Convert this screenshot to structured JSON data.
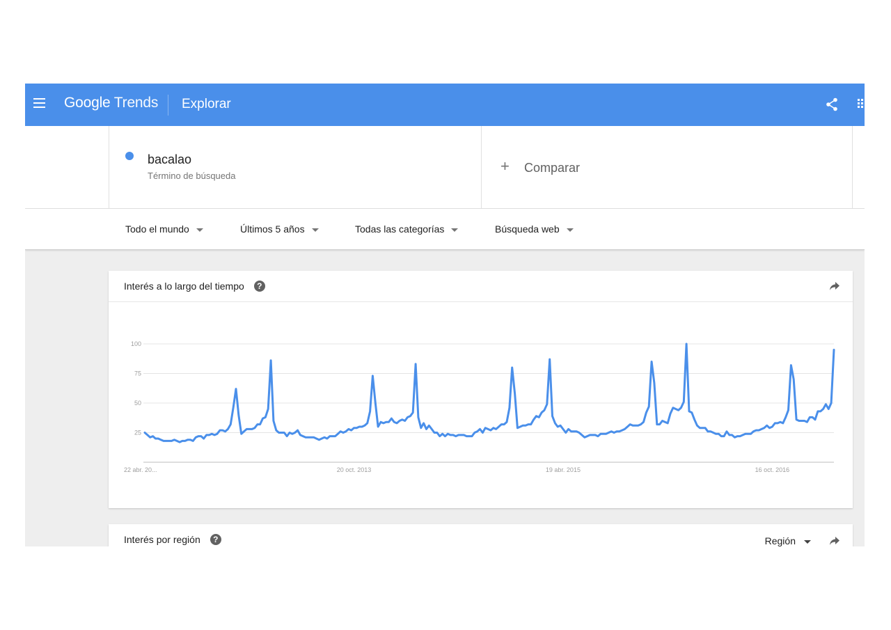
{
  "topbar": {
    "brand_google": "Google",
    "brand_trends": "Trends",
    "section": "Explorar",
    "menu_icon": "hamburger-menu-icon",
    "share_icon": "share-icon",
    "apps_icon": "apps-grid-icon"
  },
  "terms": {
    "term": "bacalao",
    "term_type": "Término de búsqueda",
    "term_color": "#4a8fea",
    "compare_label": "Comparar"
  },
  "filters": {
    "region": "Todo el mundo",
    "period": "Últimos 5 años",
    "category": "Todas las categorías",
    "search_type": "Búsqueda web"
  },
  "interest_over_time": {
    "title": "Interés a lo largo del tiempo",
    "help_icon": "help-icon",
    "share_icon": "share-arrow-icon"
  },
  "interest_by_region": {
    "title": "Interés por región",
    "resolution": "Región",
    "help_icon": "help-icon",
    "share_icon": "share-arrow-icon"
  },
  "colors": {
    "accent": "#4a8fea",
    "line": "#4a8fea",
    "background": "#eeeeee"
  },
  "chart_data": {
    "type": "line",
    "title": "",
    "xlabel": "",
    "ylabel": "",
    "ylim": [
      0,
      100
    ],
    "yticks": [
      25,
      50,
      75,
      100
    ],
    "x_tick_labels": [
      "22 abr. 20...",
      "20 oct. 2013",
      "19 abr. 2015",
      "16 oct. 2016"
    ],
    "x_tick_index": [
      0,
      78,
      156,
      234
    ],
    "grid": true,
    "series": [
      {
        "values": [
          25,
          23,
          21,
          22,
          20,
          20,
          19,
          18,
          18,
          18,
          18,
          19,
          18,
          17,
          18,
          18,
          19,
          19,
          18,
          21,
          22,
          22,
          20,
          23,
          23,
          24,
          23,
          24,
          27,
          27,
          26,
          28,
          32,
          46,
          62,
          40,
          24,
          26,
          28,
          28,
          28,
          29,
          32,
          32,
          37,
          38,
          45,
          86,
          35,
          27,
          25,
          25,
          25,
          22,
          25,
          24,
          25,
          27,
          23,
          22,
          21,
          21,
          21,
          21,
          20,
          19,
          20,
          21,
          20,
          22,
          22,
          22,
          24,
          26,
          25,
          26,
          28,
          27,
          29,
          29,
          30,
          30,
          31,
          33,
          43,
          73,
          50,
          30,
          34,
          33,
          34,
          34,
          37,
          34,
          33,
          35,
          36,
          35,
          38,
          39,
          42,
          83,
          38,
          29,
          33,
          28,
          31,
          28,
          25,
          25,
          22,
          24,
          22,
          24,
          23,
          23,
          22,
          23,
          23,
          23,
          22,
          22,
          22,
          25,
          26,
          28,
          25,
          29,
          28,
          27,
          29,
          28,
          30,
          32,
          32,
          34,
          46,
          80,
          58,
          29,
          30,
          31,
          31,
          32,
          32,
          36,
          39,
          38,
          42,
          44,
          49,
          87,
          39,
          33,
          30,
          31,
          28,
          25,
          28,
          26,
          26,
          26,
          25,
          23,
          21,
          22,
          23,
          23,
          23,
          22,
          24,
          24,
          24,
          25,
          26,
          25,
          26,
          26,
          27,
          28,
          30,
          32,
          31,
          31,
          31,
          32,
          34,
          42,
          47,
          85,
          67,
          32,
          32,
          35,
          34,
          33,
          41,
          46,
          45,
          44,
          46,
          51,
          100,
          43,
          42,
          36,
          31,
          29,
          29,
          29,
          26,
          26,
          25,
          24,
          24,
          22,
          22,
          26,
          23,
          23,
          21,
          22,
          22,
          23,
          24,
          24,
          24,
          26,
          27,
          27,
          28,
          29,
          31,
          29,
          30,
          33,
          33,
          34,
          33,
          38,
          44,
          82,
          70,
          36,
          35,
          35,
          35,
          34,
          38,
          38,
          36,
          43,
          43,
          45,
          49,
          45,
          50,
          95
        ]
      }
    ]
  }
}
